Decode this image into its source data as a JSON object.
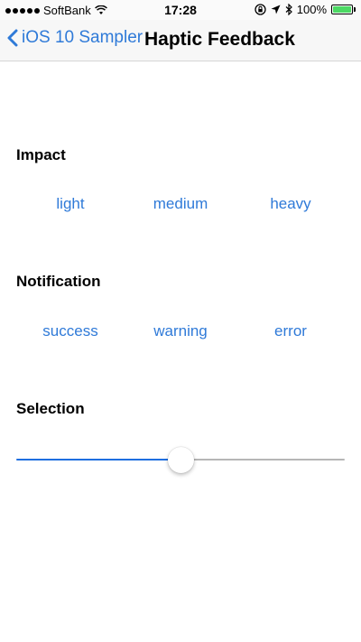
{
  "status_bar": {
    "carrier": "SoftBank",
    "time": "17:28",
    "battery": "100%",
    "battery_level": 1.0,
    "icons": [
      "signal-dots-icon",
      "wifi-icon",
      "rotation-lock-icon",
      "location-arrow-icon",
      "bluetooth-icon",
      "battery-icon"
    ]
  },
  "nav": {
    "back_label": "iOS 10 Sampler",
    "title": "Haptic Feedback"
  },
  "impact": {
    "title": "Impact",
    "buttons": [
      "light",
      "medium",
      "heavy"
    ]
  },
  "notification": {
    "title": "Notification",
    "buttons": [
      "success",
      "warning",
      "error"
    ]
  },
  "selection": {
    "title": "Selection",
    "slider_value": 0.5
  },
  "colors": {
    "accent": "#2f7ad8",
    "slider_min_track": "#1f6fe0",
    "slider_max_track": "#b6b6b6",
    "battery_fill": "#4cd964"
  }
}
